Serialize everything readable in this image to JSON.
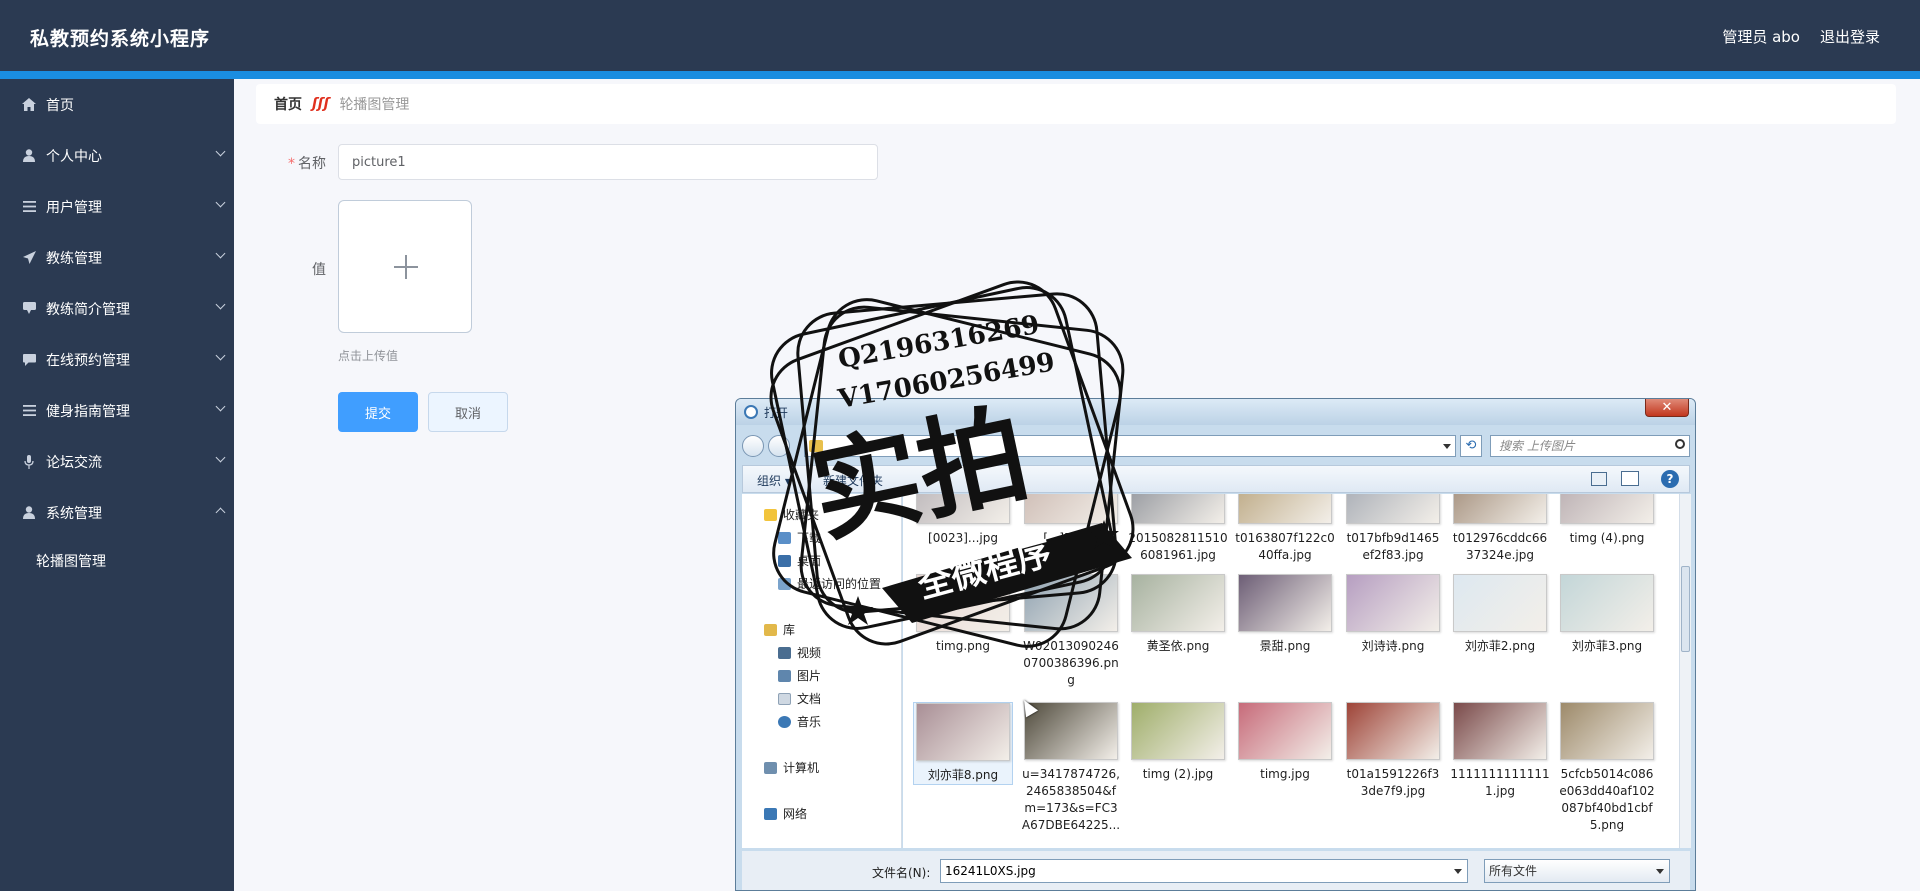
{
  "header": {
    "title": "私教预约系统小程序",
    "admin": "管理员 abo",
    "logout": "退出登录"
  },
  "colors": {
    "header_bg": "#2b3a52",
    "accent": "#1a8de0",
    "primary_button": "#409eff",
    "required": "#f56c6c"
  },
  "sidebar": {
    "items": [
      {
        "label": "首页",
        "icon": "home-icon",
        "expandable": false
      },
      {
        "label": "个人中心",
        "icon": "user-icon",
        "expandable": true
      },
      {
        "label": "用户管理",
        "icon": "menu-icon",
        "expandable": true
      },
      {
        "label": "教练管理",
        "icon": "send-icon",
        "expandable": true
      },
      {
        "label": "教练简介管理",
        "icon": "comment-icon",
        "expandable": true
      },
      {
        "label": "在线预约管理",
        "icon": "chat-icon",
        "expandable": true
      },
      {
        "label": "健身指南管理",
        "icon": "menu-icon",
        "expandable": true
      },
      {
        "label": "论坛交流",
        "icon": "mic-icon",
        "expandable": true
      },
      {
        "label": "系统管理",
        "icon": "user-icon",
        "expandable": true,
        "expanded": true
      }
    ],
    "subitems": [
      {
        "label": "轮播图管理"
      }
    ]
  },
  "breadcrumb": {
    "home": "首页",
    "separator": "ʃʃʃ",
    "current": "轮播图管理"
  },
  "form": {
    "name_required": "*",
    "name_label": "名称",
    "name_value": "picture1",
    "value_label": "值",
    "upload_hint": "点击上传值",
    "submit": "提交",
    "cancel": "取消"
  },
  "dialog": {
    "title": "打开",
    "close": "✕",
    "search_placeholder": "搜索 上传图片",
    "toolbar": {
      "organize": "组织 ▾",
      "new_folder": "新建文件夹",
      "help": "?"
    },
    "tree": [
      {
        "label": "收藏夹",
        "color": "#f2c43c"
      },
      {
        "label": "下载",
        "color": "#5a8fc8"
      },
      {
        "label": "桌面",
        "color": "#3b6fa8"
      },
      {
        "label": "最近访问的位置",
        "color": "#7aa3cc"
      },
      {
        "label": "库",
        "color": "#e2b84a"
      },
      {
        "label": "视频",
        "color": "#4a6d90"
      },
      {
        "label": "图片",
        "color": "#5f86ad"
      },
      {
        "label": "文档",
        "color": "#cfd8e2"
      },
      {
        "label": "音乐",
        "color": "#3b78b5"
      },
      {
        "label": "计算机",
        "color": "#6f8fae"
      },
      {
        "label": "网络",
        "color": "#3b78b5"
      }
    ],
    "files_row1": [
      {
        "name": "[0023]...jpg",
        "color": "#b7b2b6"
      },
      {
        "name": "[...]5].jpg",
        "color": "#c9b6ae"
      },
      {
        "name": "20150828115106081961.jpg",
        "color": "#8a8e96"
      },
      {
        "name": "t0163807f122c040ffa.jpg",
        "color": "#b7a27a"
      },
      {
        "name": "t017bfb9d1465ef2f83.jpg",
        "color": "#a0a6b0"
      },
      {
        "name": "t012976cddc6637324e.jpg",
        "color": "#9c8672"
      },
      {
        "name": "timg (4).png",
        "color": "#b4a8ac"
      }
    ],
    "files_row2": [
      {
        "name": "timg.png",
        "color": "#e7d6d2"
      },
      {
        "name": "W020130902460700386396.png",
        "color": "#8fa2b1"
      },
      {
        "name": "黄圣依.png",
        "color": "#a7b2a0"
      },
      {
        "name": "景甜.png",
        "color": "#6d5e76"
      },
      {
        "name": "刘诗诗.png",
        "color": "#b69ec1"
      },
      {
        "name": "刘亦菲2.png",
        "color": "#dde8f0"
      },
      {
        "name": "刘亦菲3.png",
        "color": "#c3d6d8"
      }
    ],
    "files_row3": [
      {
        "name": "刘亦菲8.png",
        "color": "#a98f96",
        "selected": true
      },
      {
        "name": "u=3417874726,2465838504&fm=173&s=FC3A67DBE64225...",
        "color": "#4f4a3c"
      },
      {
        "name": "timg (2).jpg",
        "color": "#9fae6a"
      },
      {
        "name": "timg.jpg",
        "color": "#c76b7a"
      },
      {
        "name": "t01a1591226f33de7f9.jpg",
        "color": "#9e4438"
      },
      {
        "name": "11111111111111.jpg",
        "color": "#7a4a4a"
      },
      {
        "name": "5cfcb5014c086e063dd40af102087bf40bd1cbf5.png",
        "color": "#9d8a6a"
      }
    ],
    "filename_label": "文件名(N):",
    "filename_value": "16241L0XS.jpg",
    "filetype": "所有文件"
  },
  "watermark": {
    "line1": "Q2196316269",
    "line2": "V17060256499",
    "big": "实拍",
    "ribbon": "全微程序"
  }
}
